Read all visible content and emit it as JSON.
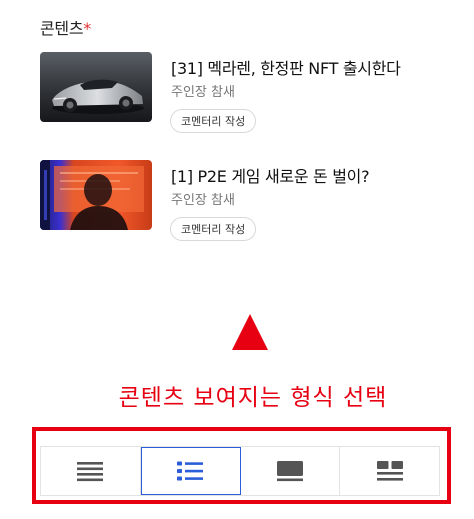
{
  "section": {
    "title": "콘텐츠",
    "required_mark": "*"
  },
  "contents": [
    {
      "title": "[31] 멕라렌, 한정판 NFT 출시한다",
      "author": "주인장 참새",
      "commentary_label": "코멘터리 작성",
      "thumbnail": "sports-car-image"
    },
    {
      "title": "[1] P2E 게임 새로운 돈 벌이?",
      "author": "주인장 참새",
      "commentary_label": "코멘터리 작성",
      "thumbnail": "gamer-silhouette-image"
    }
  ],
  "annotation": {
    "text": "콘텐츠 보여지는 형식 선택",
    "color": "#e60012"
  },
  "view_options": [
    {
      "icon": "list-lines-icon",
      "active": false
    },
    {
      "icon": "list-bullets-icon",
      "active": true
    },
    {
      "icon": "card-icon",
      "active": false
    },
    {
      "icon": "grid-icon",
      "active": false
    }
  ],
  "colors": {
    "accent": "#2b5fd9",
    "required": "#e03131",
    "icon_inactive": "#555555"
  }
}
